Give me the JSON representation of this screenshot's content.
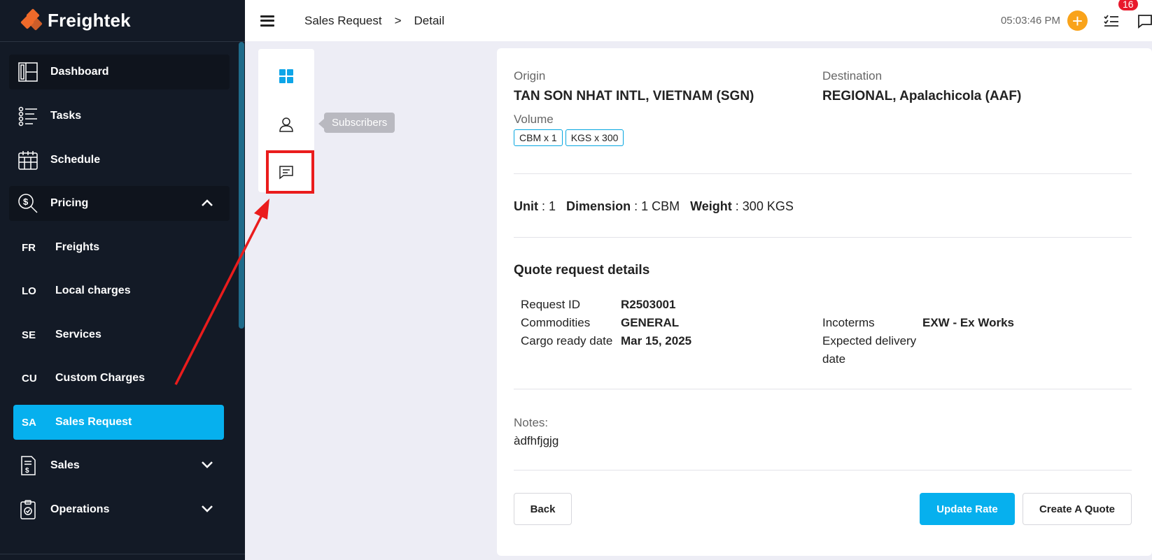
{
  "brand": {
    "name": "Freightek",
    "accent": "#ef6a2a"
  },
  "sidebar": {
    "items": [
      {
        "label": "Dashboard",
        "icon": "dashboard-icon"
      },
      {
        "label": "Tasks",
        "icon": "tasks-icon"
      },
      {
        "label": "Schedule",
        "icon": "calendar-icon"
      },
      {
        "label": "Pricing",
        "icon": "pricing-icon"
      }
    ],
    "pricing_sub": [
      {
        "abbr": "FR",
        "label": "Freights"
      },
      {
        "abbr": "LO",
        "label": "Local charges"
      },
      {
        "abbr": "SE",
        "label": "Services"
      },
      {
        "abbr": "CU",
        "label": "Custom Charges"
      },
      {
        "abbr": "SA",
        "label": "Sales Request"
      }
    ],
    "items_after": [
      {
        "label": "Sales",
        "icon": "invoice-icon"
      },
      {
        "label": "Operations",
        "icon": "clipboard-icon"
      }
    ],
    "active_color": "#06b0ee"
  },
  "header": {
    "breadcrumb": [
      "Sales Request",
      ">",
      "Detail"
    ],
    "time": "05:03:46 PM",
    "notification_count": "16"
  },
  "icon_panel": {
    "tooltip": "Subscribers"
  },
  "detail": {
    "origin_label": "Origin",
    "origin_value": "TAN SON NHAT INTL, VIETNAM (SGN)",
    "destination_label": "Destination",
    "destination_value": "REGIONAL, Apalachicola (AAF)",
    "volume_label": "Volume",
    "volume_tags": [
      "CBM x 1",
      "KGS x 300"
    ],
    "unit_label": "Unit",
    "unit_value": "1",
    "dimension_label": "Dimension",
    "dimension_value": "1 CBM",
    "weight_label": "Weight",
    "weight_value": "300 KGS",
    "section_title": "Quote request details",
    "request_id_label": "Request ID",
    "request_id_value": "R2503001",
    "commodities_label": "Commodities",
    "commodities_value": "GENERAL",
    "cargo_ready_label": "Cargo ready date",
    "cargo_ready_value": "Mar 15, 2025",
    "incoterms_label": "Incoterms",
    "incoterms_value": "EXW - Ex Works",
    "expected_delivery_label_1": "Expected delivery",
    "expected_delivery_label_2": "date",
    "notes_label": "Notes:",
    "notes_value": "àdfhfjgjg"
  },
  "actions": {
    "back": "Back",
    "update_rate": "Update Rate",
    "create_quote": "Create A Quote"
  }
}
